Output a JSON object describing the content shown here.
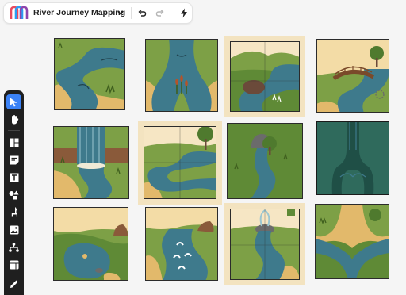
{
  "header": {
    "project_title": "River Journey Mapping",
    "icons": [
      "app-logo-icon",
      "chevron-down-icon",
      "undo-icon",
      "redo-icon",
      "lightning-icon"
    ]
  },
  "toolbar": {
    "tools": [
      "cursor-icon",
      "hand-icon",
      "layout-icon",
      "sticky-note-icon",
      "text-icon",
      "shapes-icon",
      "llama-icon",
      "image-icon",
      "tree-icon",
      "table-icon",
      "pencil-icon"
    ],
    "active_tool": "cursor-icon"
  },
  "colors": {
    "water": "#3e7a8c",
    "water_dark": "#1f3f4a",
    "grass": "#7da046",
    "grass_dark": "#5a7a2e",
    "sand": "#e2b96b",
    "accent": "#3b82f6"
  },
  "tiles": [
    {
      "id": "tile-1",
      "scene": "winding river"
    },
    {
      "id": "tile-2",
      "scene": "river fork with reeds"
    },
    {
      "id": "tile-3",
      "scene": "river with hills and rock"
    },
    {
      "id": "tile-4",
      "scene": "footbridge over stream"
    },
    {
      "id": "tile-5",
      "scene": "waterfall"
    },
    {
      "id": "tile-6",
      "scene": "meandering river with tree"
    },
    {
      "id": "tile-7",
      "scene": "river from rock with tree"
    },
    {
      "id": "tile-8",
      "scene": "river tributaries"
    },
    {
      "id": "tile-9",
      "scene": "pond with rock"
    },
    {
      "id": "tile-10",
      "scene": "rapids"
    },
    {
      "id": "tile-11",
      "scene": "fountain spring"
    },
    {
      "id": "tile-12",
      "scene": "river confluence"
    }
  ]
}
